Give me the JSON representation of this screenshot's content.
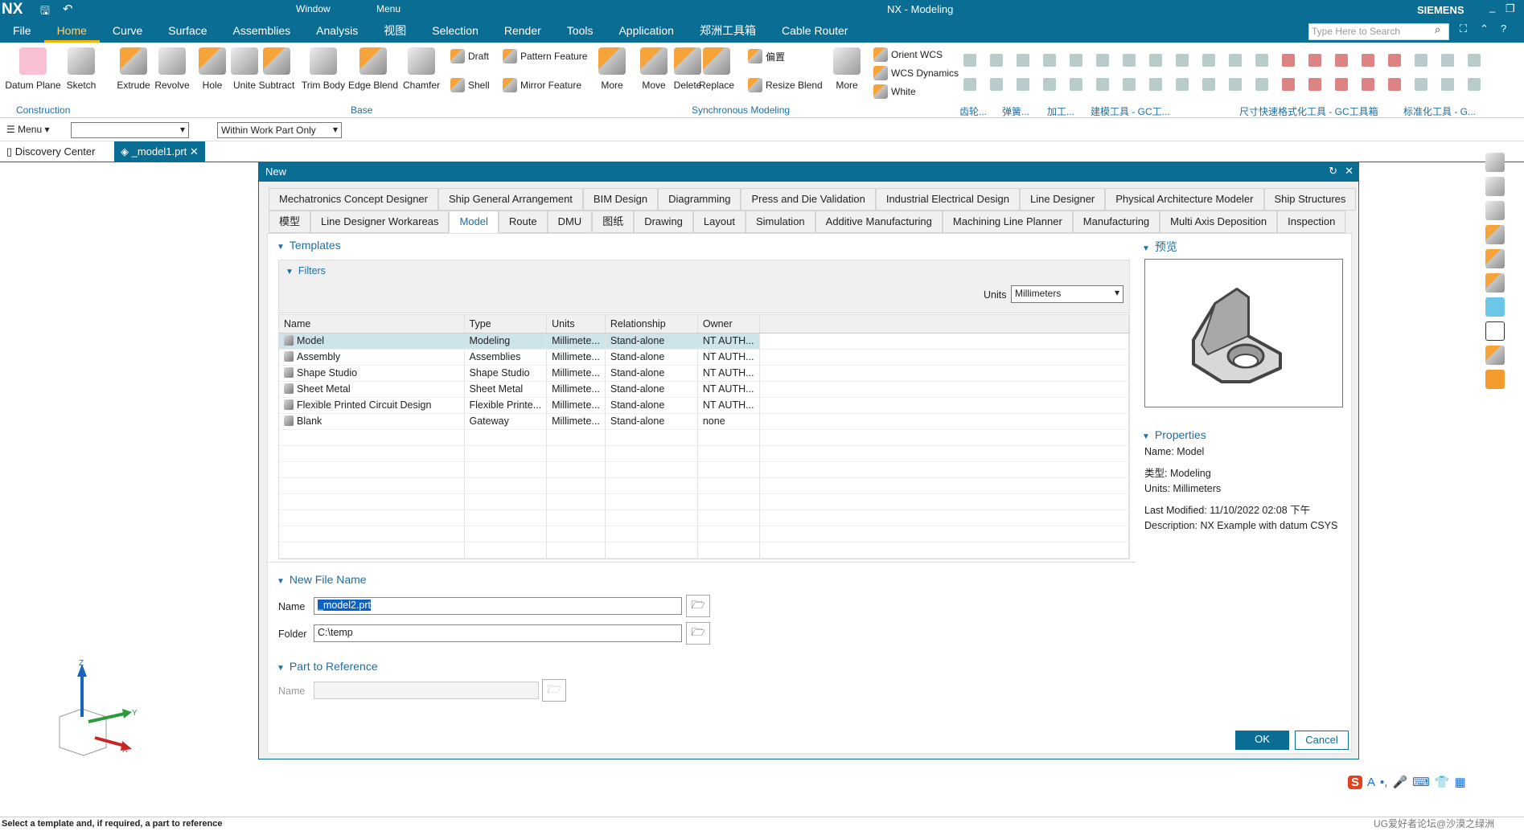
{
  "app": {
    "logo": "NX",
    "title": "NX - Modeling",
    "brand": "SIEMENS",
    "quick_access": {
      "window": "Window",
      "menu": "Menu"
    }
  },
  "menubar": [
    "File",
    "Home",
    "Curve",
    "Surface",
    "Assemblies",
    "Analysis",
    "视图",
    "Selection",
    "Render",
    "Tools",
    "Application",
    "郑洲工具箱",
    "Cable Router"
  ],
  "search": {
    "placeholder": "Type Here to Search"
  },
  "ribbon": {
    "construction": [
      "Datum Plane",
      "Sketch"
    ],
    "construction_label": "Construction",
    "base": [
      "Extrude",
      "Revolve",
      "Hole",
      "Unite",
      "Subtract",
      "Trim Body",
      "Edge Blend",
      "Chamfer"
    ],
    "base_small": [
      "Draft",
      "Shell",
      "Pattern Feature",
      "Mirror Feature"
    ],
    "base_more": "More",
    "base_label": "Base",
    "sync": [
      "Move",
      "Delete",
      "Replace"
    ],
    "sync_small": [
      "偏置",
      "Resize Blend"
    ],
    "sync_more": "More",
    "sync_label": "Synchronous Modeling",
    "wcs": [
      "Orient WCS",
      "WCS Dynamics",
      "White"
    ],
    "groups": [
      "齿轮...",
      "弹簧...",
      "加工...",
      "建模工具 - GC工...",
      "尺寸快速格式化工具 - GC工具箱",
      "标准化工具 - G..."
    ]
  },
  "toolbar": {
    "menu": "Menu",
    "selection_filter": "",
    "scope": "Within Work Part Only"
  },
  "doc_tabs": [
    "Discovery Center",
    "_model1.prt"
  ],
  "dialog": {
    "title": "New",
    "tabs_row1": [
      "Mechatronics Concept Designer",
      "Ship General Arrangement",
      "BIM Design",
      "Diagramming",
      "Press and Die Validation",
      "Industrial Electrical Design",
      "Line Designer",
      "Physical Architecture Modeler",
      "Ship Structures"
    ],
    "tabs_row2": [
      "模型",
      "Line Designer Workareas",
      "Model",
      "Route",
      "DMU",
      "图纸",
      "Drawing",
      "Layout",
      "Simulation",
      "Additive Manufacturing",
      "Machining Line Planner",
      "Manufacturing",
      "Multi Axis Deposition",
      "Inspection"
    ],
    "active_tab": "Model",
    "templates_label": "Templates",
    "filters_label": "Filters",
    "units_label": "Units",
    "units_value": "Millimeters",
    "columns": [
      "Name",
      "Type",
      "Units",
      "Relationship",
      "Owner"
    ],
    "rows": [
      [
        "Model",
        "Modeling",
        "Millimete...",
        "Stand-alone",
        "NT AUTH..."
      ],
      [
        "Assembly",
        "Assemblies",
        "Millimete...",
        "Stand-alone",
        "NT AUTH..."
      ],
      [
        "Shape Studio",
        "Shape Studio",
        "Millimete...",
        "Stand-alone",
        "NT AUTH..."
      ],
      [
        "Sheet Metal",
        "Sheet Metal",
        "Millimete...",
        "Stand-alone",
        "NT AUTH..."
      ],
      [
        "Flexible Printed Circuit Design",
        "Flexible Printe...",
        "Millimete...",
        "Stand-alone",
        "NT AUTH..."
      ],
      [
        "Blank",
        "Gateway",
        "Millimete...",
        "Stand-alone",
        "none"
      ]
    ],
    "preview_label": "预览",
    "properties_label": "Properties",
    "properties": [
      "Name: Model",
      "类型: Modeling",
      "Units: Millimeters",
      "Last Modified: 11/10/2022 02:08 下午",
      "Description: NX Example with datum CSYS"
    ],
    "new_file_label": "New File Name",
    "name_label": "Name",
    "name_value": "_model2.prt",
    "folder_label": "Folder",
    "folder_value": "C:\\temp",
    "part_ref_label": "Part to Reference",
    "ref_name_label": "Name",
    "ref_name_value": "",
    "ok": "OK",
    "cancel": "Cancel"
  },
  "triad": {
    "x": "X",
    "y": "Y",
    "z": "Z"
  },
  "status": "Select a template and, if required, a part to reference",
  "watermark": "UG爱好者论坛@沙漠之绿洲",
  "colors": {
    "accent": "#0a6d94",
    "highlight": "#f5b700",
    "selected_row": "#cde4ea",
    "ok_button": "#0a6d94"
  }
}
